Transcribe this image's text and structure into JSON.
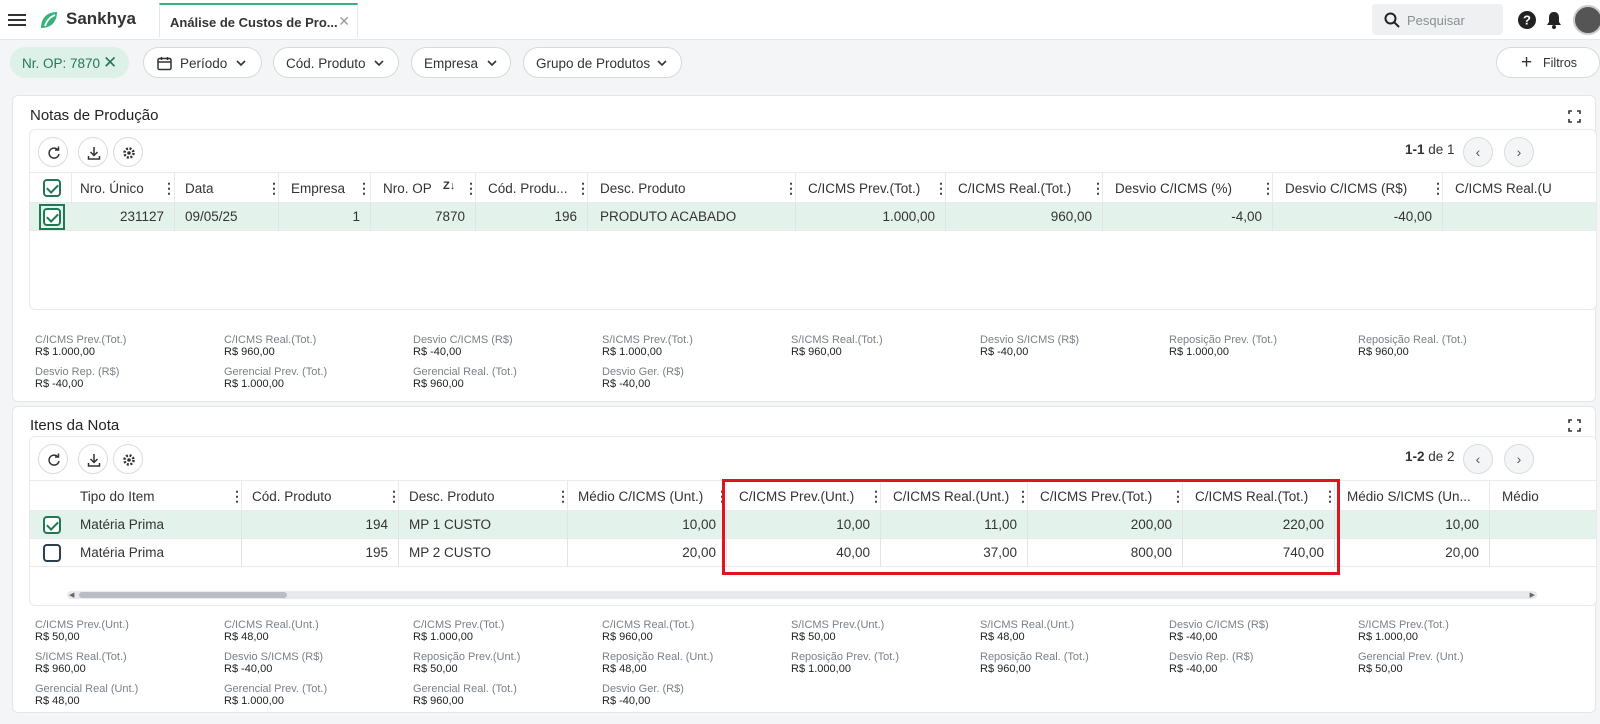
{
  "app": {
    "brand": "Sankhya",
    "tab_title": "Análise de Custos de Pro...",
    "search_placeholder": "Pesquisar"
  },
  "filters": {
    "op_chip": "Nr. OP: 7870",
    "periodo": "Período",
    "cod_produto": "Cód. Produto",
    "empresa": "Empresa",
    "grupo": "Grupo de Produtos",
    "filtros_button": "Filtros"
  },
  "notas": {
    "title": "Notas de Produção",
    "pager": {
      "range": "1-1",
      "of": "de 1"
    },
    "columns": [
      "Nro. Único",
      "Data",
      "Empresa",
      "Nro. OP",
      "Cód. Produ...",
      "Desc. Produto",
      "C/ICMS Prev.(Tot.)",
      "C/ICMS Real.(Tot.)",
      "Desvio C/ICMS (%)",
      "Desvio C/ICMS (R$)",
      "C/ICMS Real.(U"
    ],
    "rows": [
      [
        "231127",
        "09/05/25",
        "1",
        "7870",
        "196",
        "PRODUTO ACABADO",
        "1.000,00",
        "960,00",
        "-4,00",
        "-40,00"
      ]
    ],
    "totals": [
      {
        "k": "C/ICMS Prev.(Tot.)",
        "v": "R$ 1.000,00"
      },
      {
        "k": "C/ICMS Real.(Tot.)",
        "v": "R$ 960,00"
      },
      {
        "k": "Desvio C/ICMS (R$)",
        "v": "R$ -40,00"
      },
      {
        "k": "S/ICMS Prev.(Tot.)",
        "v": "R$ 1.000,00"
      },
      {
        "k": "S/ICMS Real.(Tot.)",
        "v": "R$ 960,00"
      },
      {
        "k": "Desvio S/ICMS (R$)",
        "v": "R$ -40,00"
      },
      {
        "k": "Reposição Prev. (Tot.)",
        "v": "R$ 1.000,00"
      },
      {
        "k": "Reposição Real. (Tot.)",
        "v": "R$ 960,00"
      },
      {
        "k": "Desvio Rep. (R$)",
        "v": "R$ -40,00"
      },
      {
        "k": "Gerencial Prev. (Tot.)",
        "v": "R$ 1.000,00"
      },
      {
        "k": "Gerencial Real. (Tot.)",
        "v": "R$ 960,00"
      },
      {
        "k": "Desvio Ger. (R$)",
        "v": "R$ -40,00"
      }
    ]
  },
  "itens": {
    "title": "Itens da Nota",
    "pager": {
      "range": "1-2",
      "of": "de 2"
    },
    "columns": [
      "Tipo do Item",
      "Cód. Produto",
      "Desc. Produto",
      "Médio C/ICMS (Unt.)",
      "C/ICMS Prev.(Unt.)",
      "C/ICMS Real.(Unt.)",
      "C/ICMS Prev.(Tot.)",
      "C/ICMS Real.(Tot.)",
      "Médio S/ICMS (Un...",
      "Médio"
    ],
    "rows": [
      [
        "Matéria Prima",
        "194",
        "MP 1 CUSTO",
        "10,00",
        "10,00",
        "11,00",
        "200,00",
        "220,00",
        "10,00"
      ],
      [
        "Matéria Prima",
        "195",
        "MP 2 CUSTO",
        "20,00",
        "40,00",
        "37,00",
        "800,00",
        "740,00",
        "20,00"
      ]
    ],
    "totals": [
      {
        "k": "C/ICMS Prev.(Unt.)",
        "v": "R$ 50,00"
      },
      {
        "k": "C/ICMS Real.(Unt.)",
        "v": "R$ 48,00"
      },
      {
        "k": "C/ICMS Prev.(Tot.)",
        "v": "R$ 1.000,00"
      },
      {
        "k": "C/ICMS Real.(Tot.)",
        "v": "R$ 960,00"
      },
      {
        "k": "S/ICMS Prev.(Unt.)",
        "v": "R$ 50,00"
      },
      {
        "k": "S/ICMS Real.(Unt.)",
        "v": "R$ 48,00"
      },
      {
        "k": "Desvio C/ICMS (R$)",
        "v": "R$ -40,00"
      },
      {
        "k": "S/ICMS Prev.(Tot.)",
        "v": "R$ 1.000,00"
      },
      {
        "k": "S/ICMS Real.(Tot.)",
        "v": "R$ 960,00"
      },
      {
        "k": "Desvio S/ICMS (R$)",
        "v": "R$ -40,00"
      },
      {
        "k": "Reposição Prev.(Unt.)",
        "v": "R$ 50,00"
      },
      {
        "k": "Reposição Real. (Unt.)",
        "v": "R$ 48,00"
      },
      {
        "k": "Reposição Prev. (Tot.)",
        "v": "R$ 1.000,00"
      },
      {
        "k": "Reposição Real. (Tot.)",
        "v": "R$ 960,00"
      },
      {
        "k": "Desvio Rep. (R$)",
        "v": "R$ -40,00"
      },
      {
        "k": "Gerencial Prev. (Unt.)",
        "v": "R$ 50,00"
      },
      {
        "k": "Gerencial Real (Unt.)",
        "v": "R$ 48,00"
      },
      {
        "k": "Gerencial Prev. (Tot.)",
        "v": "R$ 1.000,00"
      },
      {
        "k": "Gerencial Real. (Tot.)",
        "v": "R$ 960,00"
      },
      {
        "k": "Desvio Ger. (R$)",
        "v": "R$ -40,00"
      }
    ]
  },
  "colors": {
    "accent": "#35b27b",
    "selected_row": "#e3f3ec",
    "highlight_box": "#e0141e"
  }
}
